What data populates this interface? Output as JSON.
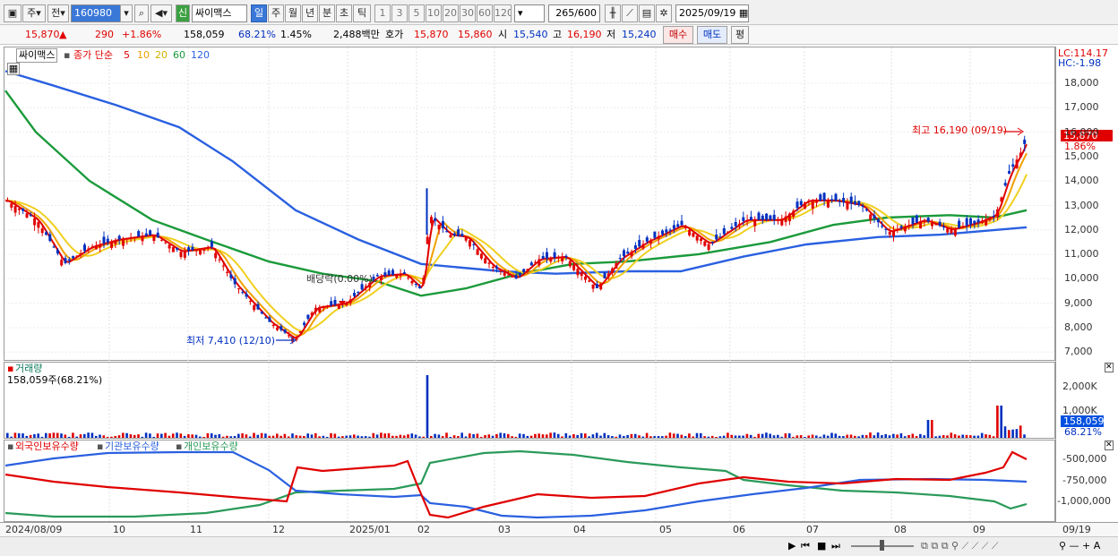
{
  "toolbar": {
    "period_mode": "주",
    "market": "전",
    "code": "160980",
    "new_badge": "신",
    "stock_name": "싸이맥스",
    "periods": [
      "일",
      "주",
      "월",
      "년",
      "분",
      "초",
      "틱"
    ],
    "active_period": "일",
    "minute_steps": [
      "1",
      "3",
      "5",
      "10",
      "20",
      "30",
      "60",
      "120"
    ],
    "data_count": "265",
    "data_total": "/600",
    "date": "2025/09/19"
  },
  "quote": {
    "price": "15,870",
    "change": "290",
    "change_pct": "+1.86%",
    "volume": "158,059",
    "volume_ratio": "68.21%",
    "turnover_pct": "1.45%",
    "amount": "2,488백만",
    "ask_label": "호가",
    "ask": "15,870",
    "bid": "15,860",
    "open_label": "시",
    "open": "15,540",
    "high_label": "고",
    "high": "16,190",
    "low_label": "저",
    "low": "15,240",
    "buy_label": "매수",
    "sell_label": "매도",
    "eval_label": "평"
  },
  "price_panel": {
    "legend_name": "싸이맥스",
    "ma_legend": "종가 단순",
    "ma_periods": [
      "5",
      "10",
      "20",
      "60",
      "120"
    ],
    "ma_colors": [
      "#e00000",
      "#f0a000",
      "#e8c800",
      "#1a9a3a",
      "#2a60e0"
    ],
    "lc": "LC:114.17",
    "hc": "HC:-1.98",
    "high_annot": "최고 16,190 (09/19)",
    "low_annot": "최저 7,410 (12/10)",
    "dividend_annot": "배당락(0.00%)",
    "last_price": "15,870",
    "last_pct": "1.86%",
    "y_ticks": [
      "18,000",
      "17,000",
      "16,000",
      "15,000",
      "14,000",
      "13,000",
      "12,000",
      "11,000",
      "10,000",
      "9,000",
      "8,000",
      "7,000"
    ]
  },
  "volume_panel": {
    "title": "거래량",
    "value": "158,059주(68.21%)",
    "y_ticks": [
      "2,000K",
      "1,000K"
    ],
    "last_volume": "158,059",
    "last_pct": "68.21%"
  },
  "holding_panel": {
    "legends": [
      "외국인보유수량",
      "기관보유수량",
      "개인보유수량"
    ],
    "colors": [
      "#e00000",
      "#2a60e0",
      "#2a9a5a"
    ],
    "y_ticks": [
      "-500,000",
      "-750,000",
      "-1,000,000"
    ]
  },
  "x_axis": {
    "labels": [
      "2024/08/09",
      "10",
      "11",
      "12",
      "2025/01",
      "02",
      "03",
      "04",
      "05",
      "06",
      "07",
      "08",
      "09"
    ],
    "end_label": "09/19"
  }
}
